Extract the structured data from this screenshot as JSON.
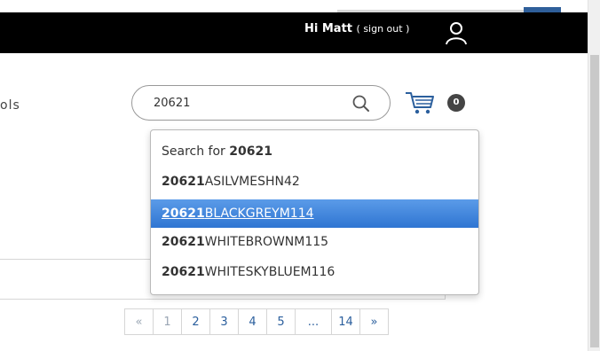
{
  "header": {
    "greeting": "Hi Matt",
    "signout": "( sign out )",
    "user_icon": "user-icon"
  },
  "nav": {
    "fragment": "ols"
  },
  "search": {
    "value": "20621",
    "placeholder": "",
    "button_icon": "search-icon"
  },
  "cart": {
    "icon": "cart-icon",
    "count": "0"
  },
  "suggestions": {
    "search_for_label": "Search for",
    "search_for_term": "20621",
    "items": [
      {
        "match": "20621",
        "rest": "ASILVMESHN42",
        "active": false
      },
      {
        "match": "20621",
        "rest": "BLACKGREYM114",
        "active": true
      },
      {
        "match": "20621",
        "rest": "WHITEBROWNM115",
        "active": false
      },
      {
        "match": "20621",
        "rest": "WHITESKYBLUEM116",
        "active": false
      }
    ]
  },
  "pagination": {
    "prev": "«",
    "pages": [
      "1",
      "2",
      "3",
      "4",
      "5"
    ],
    "ellipsis": "...",
    "last": "14",
    "next": "»",
    "current": "1"
  },
  "colors": {
    "header_bg": "#000000",
    "accent_blue": "#2f75d2",
    "link_blue": "#2b5f9d"
  }
}
